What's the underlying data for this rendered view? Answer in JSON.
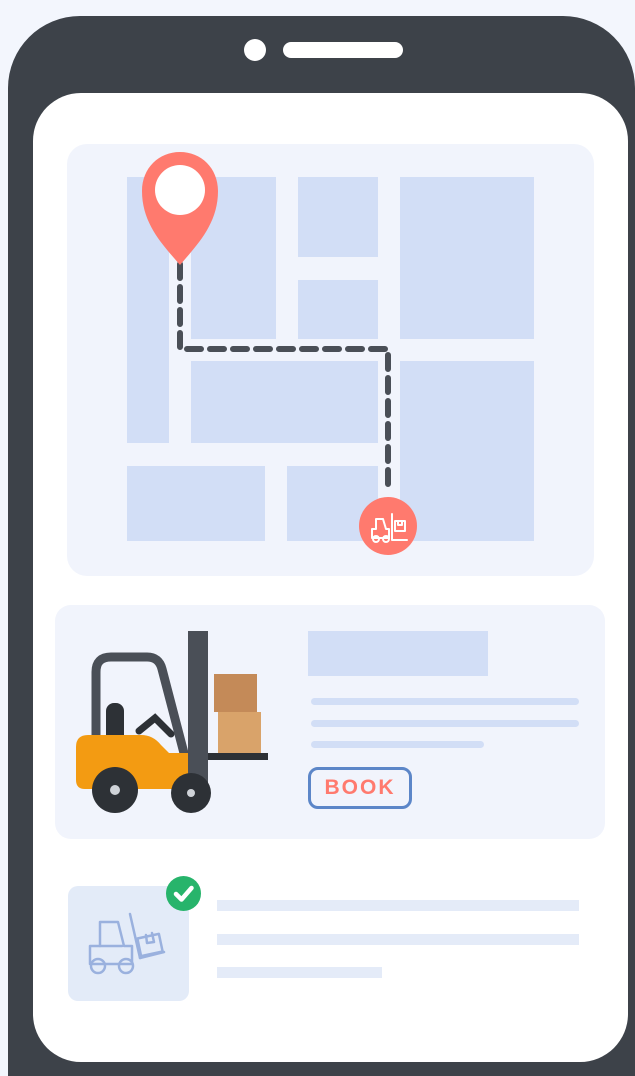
{
  "device": {
    "frame_color": "#3D4249",
    "screen_color": "#FFFFFF"
  },
  "map": {
    "background_color": "#F1F4FC",
    "block_color": "#D2DEF6",
    "route_color": "#4A4F57",
    "pin_icon": "location-pin-icon",
    "pin_color": "#FF7A6E",
    "destination_icon": "forklift-icon",
    "destination_color": "#FF7A6E"
  },
  "booking": {
    "illustration": "forklift-with-boxes",
    "book_label": "BOOK",
    "accent_color": "#FF7A6E",
    "button_border_color": "#5C86C8"
  },
  "status": {
    "thumbnail_icon": "forklift-icon",
    "badge_icon": "check-icon",
    "badge_color": "#27B46B"
  }
}
